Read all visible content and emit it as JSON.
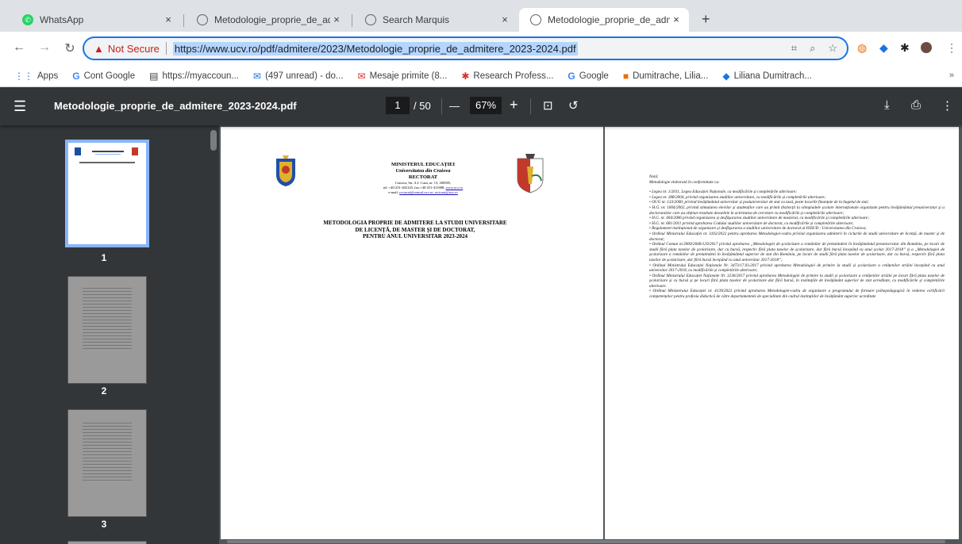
{
  "browser": {
    "tabs": [
      {
        "title": "WhatsApp",
        "favicon": "whatsapp-icon",
        "color": "#25d366",
        "active": false
      },
      {
        "title": "Metodologie_proprie_de_adm",
        "favicon": "globe-icon",
        "color": "#5f6368",
        "active": false
      },
      {
        "title": "Search Marquis",
        "favicon": "globe-icon",
        "color": "#5f6368",
        "active": false
      },
      {
        "title": "Metodologie_proprie_de_adm",
        "favicon": "globe-icon",
        "color": "#5f6368",
        "active": true
      }
    ],
    "new_tab": "+",
    "security_label": "Not Secure",
    "url": "https://www.ucv.ro/pdf/admitere/2023/Metodologie_proprie_de_admitere_2023-2024.pdf",
    "bookmarks": [
      {
        "label": "Apps",
        "icon": "apps-grid-icon"
      },
      {
        "label": "Cont Google",
        "icon": "google-icon"
      },
      {
        "label": "https://myaccoun...",
        "icon": "page-icon"
      },
      {
        "label": "(497 unread) - do...",
        "icon": "mail-icon"
      },
      {
        "label": "Mesaje primite (8...",
        "icon": "mail-icon"
      },
      {
        "label": "Research Profess...",
        "icon": "star-icon"
      },
      {
        "label": "Google",
        "icon": "google-icon"
      },
      {
        "label": "Dumitrache, Lilia...",
        "icon": "bookmark-icon"
      },
      {
        "label": "Liliana Dumitrach...",
        "icon": "bookmark-icon"
      }
    ],
    "more_bookmarks": "»"
  },
  "viewer": {
    "title": "Metodologie_proprie_de_admitere_2023-2024.pdf",
    "current_page": "1",
    "total_pages": "/ 50",
    "zoom": "67%",
    "zoom_out": "—",
    "zoom_in": "+"
  },
  "thumbnails": [
    {
      "number": "1"
    },
    {
      "number": "2"
    },
    {
      "number": "3"
    }
  ],
  "page1": {
    "ministry": "MINISTERUL EDUCAȚIEI",
    "university": "Universitatea din Craiova",
    "rectorat": "RECTORAT",
    "address": "Craiova, Str. A.I. Cuza, nr. 13, 200585,",
    "contact": "tel: +40-251-402145, fax:+40-251-411688,",
    "website": "www.ucv.ro",
    "email_label": "e-mail:",
    "email": "rectorat@central.ucv.ro; rectorat@ucv.ro",
    "title_line1": "METODOLOGIA PROPRIE DE ADMITERE LA STUDII UNIVERSITARE",
    "title_line2": "DE LICENȚĂ, DE MASTER ȘI DE DOCTORAT,",
    "title_line3": "PENTRU ANUL UNIVERSITAR 2023-2024"
  },
  "page2": {
    "note_title": "Notă:",
    "note_sub": "Metodologie elaborată în conformitate cu:",
    "items": [
      "• Legea nr. 1/2011, Legea Educației Naționale, cu modificările și completările ulterioare;",
      "• Legea nr. 288/2004, privind organizarea studiilor universitare, cu modificările și completările ulterioare;",
      "• OUG nr. 133/2000, privind învățământul universitar și postuniversitar de stat cu taxă, peste locurile finanțate de la bugetul de stat;",
      "• H.G. nr. 1004/2002, privind stimularea elevilor și studenților care au primit distincții la olimpiadele școlare internaționale organizate pentru învățământul preuniversitar și a doctoranzilor care au obținut rezultate deosebite în activitatea de cercetare cu modificările și completările ulterioare;",
      "• H.G. nr. 404/2006 privind organizarea și desfășurarea studiilor universitare de masterat, cu modificările și completările ulterioare;",
      "• H.G. nr. 681/2011 privind aprobarea Codului studiilor universitare de doctorat, cu modificările și completările ulterioare;",
      "• Regulament instituțional de organizare și desfășurarea a studiilor universitare de doctorat al IOSUD - Universitatea din Craiova;",
      "• Ordinul Ministrului Educației nr. 3102/2022 pentru aprobarea Metodologiei-cadru privind organizarea admiterii în ciclurile de studii universitare de licență, de master și de doctorat;",
      "• Ordinul Comun nr.3900/2046/129/2017 privind aprobarea „Metodologiei de școlarizare a românilor de pretutindeni în învățământul preuniversitar din România, pe locuri de studii fără plata taxelor de școlarizare, dar cu bursă, respectiv fără plata taxelor de școlarizare, dar fără bursă începând cu anul școlar 2017-2018” și a „Metodologiei de școlarizare a românilor de pretutindeni în învățământul superior de stat din România, pe locuri de studii fără plata taxelor de școlarizare, dar cu bursă, respectiv fără plata taxelor de școlarizare, dar fără bursă începând cu anul universitar 2017-2018”;",
      "• Ordinul Ministrului Educației Naționale Nr. 3473/17.03.2017 privind aprobarea Metodologiei de primire la studii și școlarizare a cetățenilor străini începând cu anul universitar 2017-2018, cu modificările și completările ulterioare;",
      "• Ordinul Ministrului Educației Naționale Nr. 3236/2017 privind aprobarea Metodologiei de primire la studii și școlarizare a cetățenilor străini pe locuri fără plata taxelor de școlarizare și cu bursă și pe locuri fără plata taxelor de școlarizare dar fără bursă, în instituțiile de învățământ superior de stat acreditate, cu modificările și completările ulterioare.",
      "• Ordinul Ministerului Educației nr. 4139/2022 privind aprobarea Metodologiei-cadru de organizare a programului de formare psihopedagogică în vederea certificării competențelor pentru profesia didactică de către departamentele de specialitate din cadrul instituțiilor de învățământ superior acreditate"
    ]
  }
}
